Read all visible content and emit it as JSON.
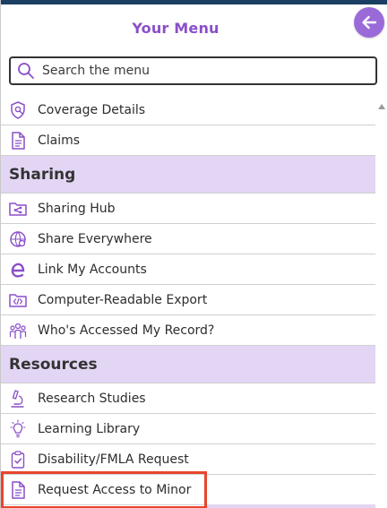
{
  "header": {
    "title": "Your Menu",
    "back_icon": "arrow-left-icon"
  },
  "search": {
    "placeholder": "Search the menu",
    "value": "",
    "icon": "search-icon"
  },
  "colors": {
    "accent": "#8a4fc9",
    "section_bg": "#e3d6f4",
    "highlight": "#e8452c",
    "back_button": "#9b6ad9"
  },
  "menu": {
    "top_items": [
      {
        "label": "Coverage Details",
        "icon": "shield-search-icon"
      },
      {
        "label": "Claims",
        "icon": "document-icon"
      }
    ],
    "sections": [
      {
        "title": "Sharing",
        "items": [
          {
            "label": "Sharing Hub",
            "icon": "folder-share-icon"
          },
          {
            "label": "Share Everywhere",
            "icon": "globe-share-icon"
          },
          {
            "label": "Link My Accounts",
            "icon": "link-e-icon"
          },
          {
            "label": "Computer-Readable Export",
            "icon": "code-folder-icon"
          },
          {
            "label": "Who's Accessed My Record?",
            "icon": "people-icon"
          }
        ]
      },
      {
        "title": "Resources",
        "items": [
          {
            "label": "Research Studies",
            "icon": "microscope-icon"
          },
          {
            "label": "Learning Library",
            "icon": "lightbulb-icon"
          },
          {
            "label": "Disability/FMLA Request",
            "icon": "clipboard-check-icon"
          },
          {
            "label": "Request Access to Minor",
            "icon": "document-icon"
          }
        ]
      }
    ]
  }
}
